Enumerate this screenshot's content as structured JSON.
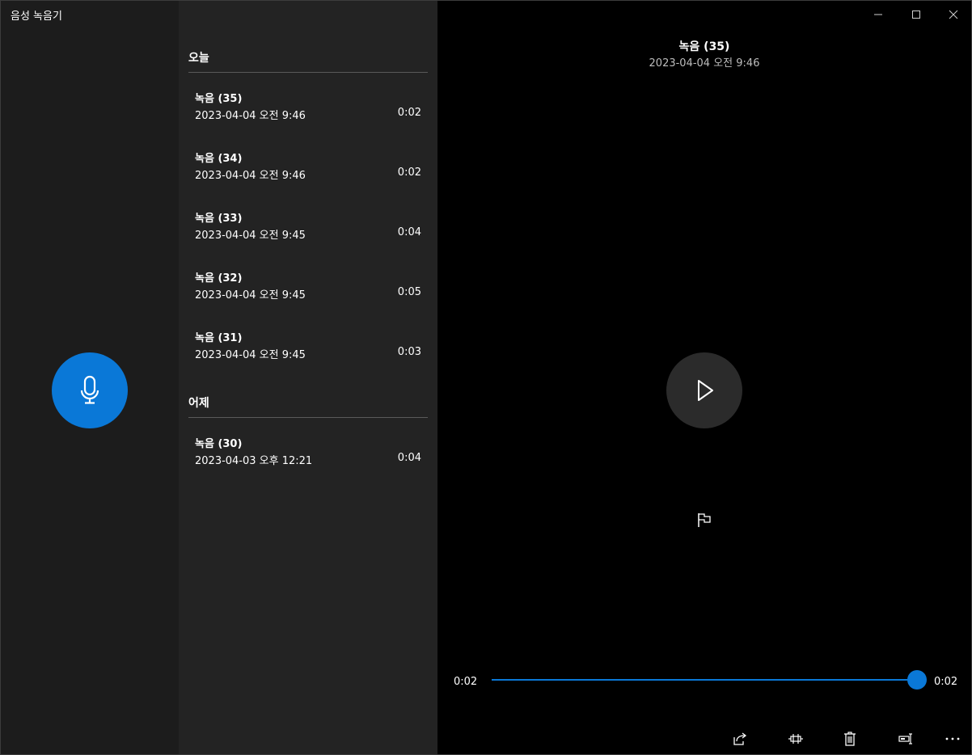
{
  "app": {
    "title": "음성 녹음기"
  },
  "colors": {
    "accent": "#0a78d7",
    "rail_bg": "#1c1c1c",
    "list_bg": "#232323",
    "player_bg": "#000000"
  },
  "groups": [
    {
      "header": "오늘",
      "items": [
        {
          "name": "녹음 (35)",
          "date": "2023-04-04 오전 9:46",
          "duration": "0:02"
        },
        {
          "name": "녹음 (34)",
          "date": "2023-04-04 오전 9:46",
          "duration": "0:02"
        },
        {
          "name": "녹음 (33)",
          "date": "2023-04-04 오전 9:45",
          "duration": "0:04"
        },
        {
          "name": "녹음 (32)",
          "date": "2023-04-04 오전 9:45",
          "duration": "0:05"
        },
        {
          "name": "녹음 (31)",
          "date": "2023-04-04 오전 9:45",
          "duration": "0:03"
        }
      ]
    },
    {
      "header": "어제",
      "items": [
        {
          "name": "녹음 (30)",
          "date": "2023-04-03 오후 12:21",
          "duration": "0:04"
        }
      ]
    }
  ],
  "player": {
    "title": "녹음 (35)",
    "date": "2023-04-04 오전 9:46",
    "current_time": "0:02",
    "total_time": "0:02",
    "progress": 1.0
  },
  "icons": {
    "record": "microphone-icon",
    "play": "play-icon",
    "marker": "flag-icon",
    "share": "share-icon",
    "trim": "trim-icon",
    "delete": "trash-icon",
    "rename": "rename-icon",
    "more": "more-icon"
  }
}
